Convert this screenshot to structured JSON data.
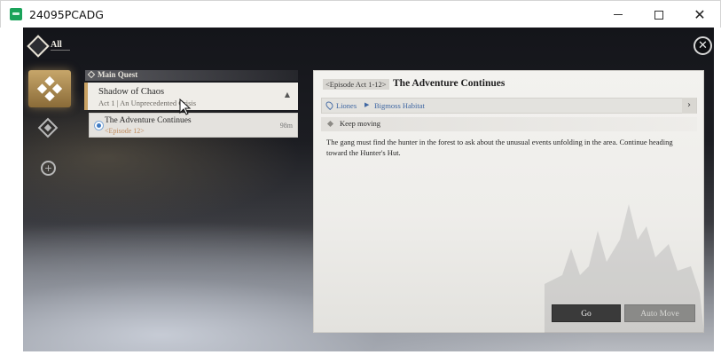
{
  "window": {
    "title": "24095PCADG",
    "minimize_icon": "minimize-icon",
    "maximize_icon": "maximize-icon",
    "close_glyph": "✕"
  },
  "menu": {
    "label": "All",
    "close_glyph": "✕"
  },
  "rail": {
    "items": [
      {
        "icon": "quest-category-icon",
        "active": true
      },
      {
        "icon": "compass-diamond-icon",
        "active": false
      },
      {
        "icon": "plus-circle-icon",
        "active": false,
        "glyph": "+"
      }
    ]
  },
  "quest_list": {
    "section_label": "Main Quest",
    "group": {
      "name": "Shadow of Chaos",
      "subtitle": "Act 1 | An Unprecedented Crisis",
      "chevron": "▲"
    },
    "items": [
      {
        "name": "The Adventure Continues",
        "episode": "<Episode 12>",
        "distance": "98m"
      }
    ]
  },
  "detail": {
    "episode_tag": "<Episode Act 1-12>",
    "title": "The Adventure Continues",
    "location": {
      "region": "Liones",
      "separator": "▶",
      "area": "Bigmoss Habitat",
      "nav_glyph": "›"
    },
    "objective": "Keep moving",
    "description": "The gang must find the hunter in the forest to ask about the unusual events unfolding in the area. Continue heading toward the Hunter's Hut.",
    "buttons": {
      "go": "Go",
      "auto_move": "Auto Move"
    }
  },
  "colors": {
    "accent_gold": "#c9a264",
    "link_blue": "#3e66a2",
    "button_dark": "#3a3a3a",
    "button_disabled": "#8a8a88"
  }
}
